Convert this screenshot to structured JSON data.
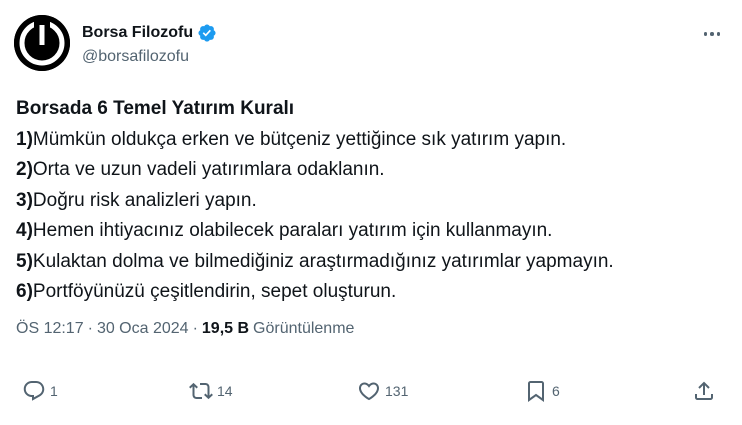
{
  "author": {
    "name": "Borsa Filozofu",
    "handle": "@borsafilozofu"
  },
  "tweet": {
    "title": "Borsada 6 Temel Yatırım Kuralı",
    "items": [
      {
        "num": "1)",
        "text": "Mümkün oldukça erken ve bütçeniz yettiğince sık yatırım yapın."
      },
      {
        "num": "2)",
        "text": "Orta ve uzun vadeli yatırımlara odaklanın."
      },
      {
        "num": "3)",
        "text": "Doğru risk analizleri yapın."
      },
      {
        "num": "4)",
        "text": "Hemen ihtiyacınız olabilecek paraları yatırım için kullanmayın."
      },
      {
        "num": "5)",
        "text": "Kulaktan dolma ve bilmediğiniz araştırmadığınız yatırımlar yapmayın."
      },
      {
        "num": "6)",
        "text": "Portföyünüzü çeşitlendirin, sepet oluşturun."
      }
    ]
  },
  "meta": {
    "time": "ÖS 12:17",
    "separator": "·",
    "date": "30 Oca 2024",
    "views_count": "19,5 B",
    "views_label": "Görüntülenme"
  },
  "actions": {
    "replies": "1",
    "retweets": "14",
    "likes": "131",
    "bookmarks": "6"
  },
  "colors": {
    "verified": "#1d9bf0",
    "secondary": "#536471",
    "primary": "#0f1419"
  },
  "icons": [
    "logo-power-icon",
    "verified-badge-icon",
    "more-icon",
    "reply-icon",
    "retweet-icon",
    "like-icon",
    "bookmark-icon",
    "share-icon"
  ]
}
